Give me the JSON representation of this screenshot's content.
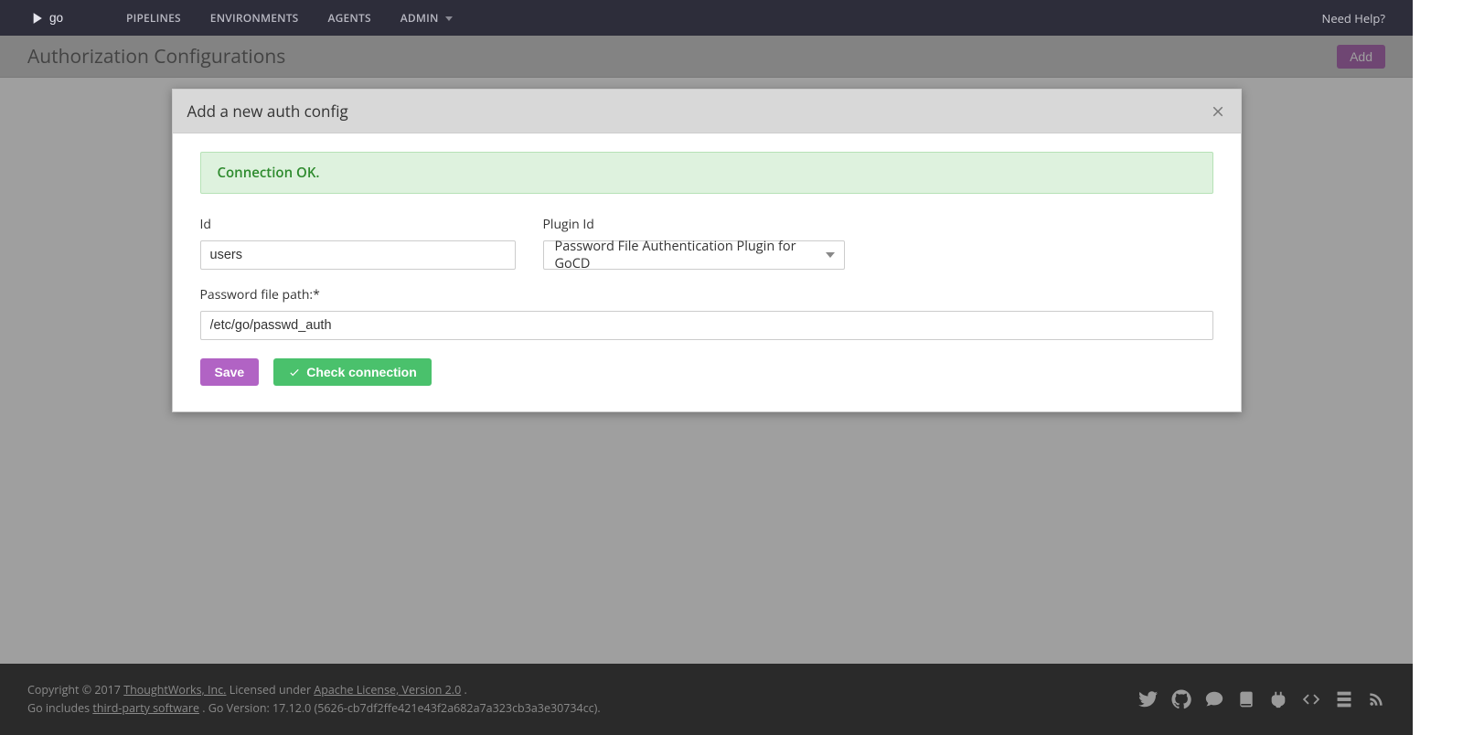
{
  "nav": {
    "items": [
      "PIPELINES",
      "ENVIRONMENTS",
      "AGENTS",
      "ADMIN"
    ],
    "help": "Need Help?"
  },
  "page": {
    "title": "Authorization Configurations",
    "add_button": "Add"
  },
  "modal": {
    "title": "Add a new auth config",
    "alert": "Connection OK.",
    "fields": {
      "id_label": "Id",
      "id_value": "users",
      "plugin_label": "Plugin Id",
      "plugin_value": "Password File Authentication Plugin for GoCD",
      "path_label": "Password file path:*",
      "path_value": "/etc/go/passwd_auth"
    },
    "actions": {
      "save": "Save",
      "check": "Check connection"
    }
  },
  "footer": {
    "copyright_prefix": "Copyright © 2017 ",
    "thoughtworks": "ThoughtWorks, Inc.",
    "licensed": " Licensed under ",
    "apache": "Apache License, Version 2.0",
    "period": ".",
    "includes_prefix": "Go includes ",
    "third_party": "third-party software",
    "version": ". Go Version: 17.12.0 (5626-cb7df2ffe421e43f2a682a7a323cb3a3e30734cc)."
  }
}
